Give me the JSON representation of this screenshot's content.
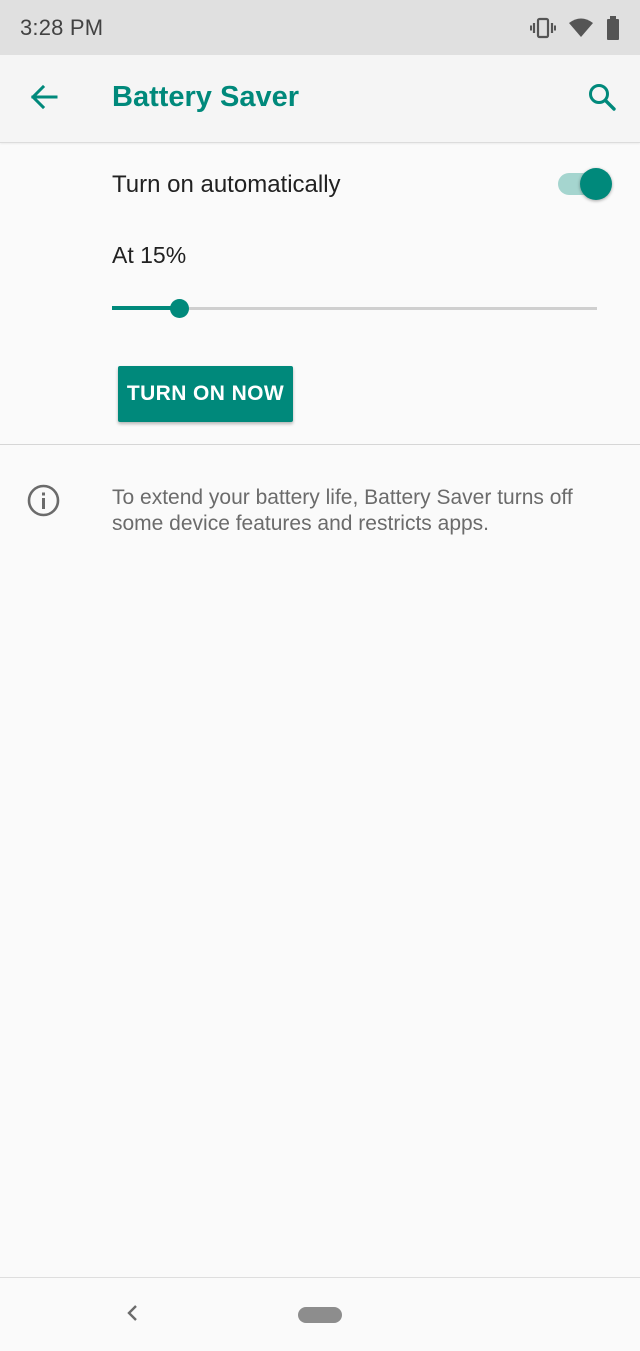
{
  "status_bar": {
    "time": "3:28 PM",
    "icons": [
      "vibrate-icon",
      "wifi-icon",
      "battery-icon"
    ]
  },
  "app_bar": {
    "title": "Battery Saver",
    "back_icon": "arrow-back-icon",
    "search_icon": "search-icon"
  },
  "auto_toggle": {
    "label": "Turn on automatically",
    "enabled": true
  },
  "threshold": {
    "label": "At 15%",
    "slider_fraction": 0.14
  },
  "turn_on_button": {
    "label": "TURN ON NOW"
  },
  "info": {
    "icon": "info-icon",
    "text": "To extend your battery life, Battery Saver turns off some device features and restricts apps."
  },
  "nav_bar": {
    "back_icon": "nav-back-icon",
    "home_icon": "nav-home-pill"
  },
  "colors": {
    "accent": "#00897b",
    "accent_light": "#a5d5cf",
    "status_bar_bg": "#e0e0e0",
    "app_bar_bg": "#f5f5f5",
    "background": "#fafafa",
    "text_primary": "#212121",
    "text_secondary": "#6b6b6b"
  }
}
